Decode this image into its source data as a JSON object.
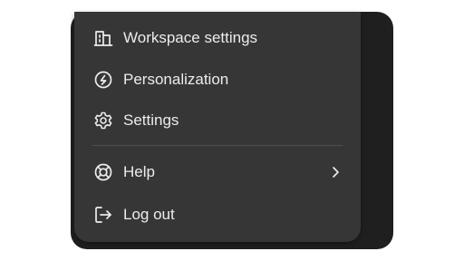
{
  "menu": {
    "items": [
      {
        "label": "Workspace settings",
        "icon": "building-icon"
      },
      {
        "label": "Personalization",
        "icon": "personalization-icon"
      },
      {
        "label": "Settings",
        "icon": "gear-icon"
      },
      {
        "label": "Help",
        "icon": "lifebuoy-icon",
        "has_submenu": true
      },
      {
        "label": "Log out",
        "icon": "logout-icon"
      }
    ]
  },
  "colors": {
    "menu_background": "#363636",
    "backdrop": "#1f1f1f",
    "text": "#ececec",
    "divider": "#4e4e4e"
  }
}
